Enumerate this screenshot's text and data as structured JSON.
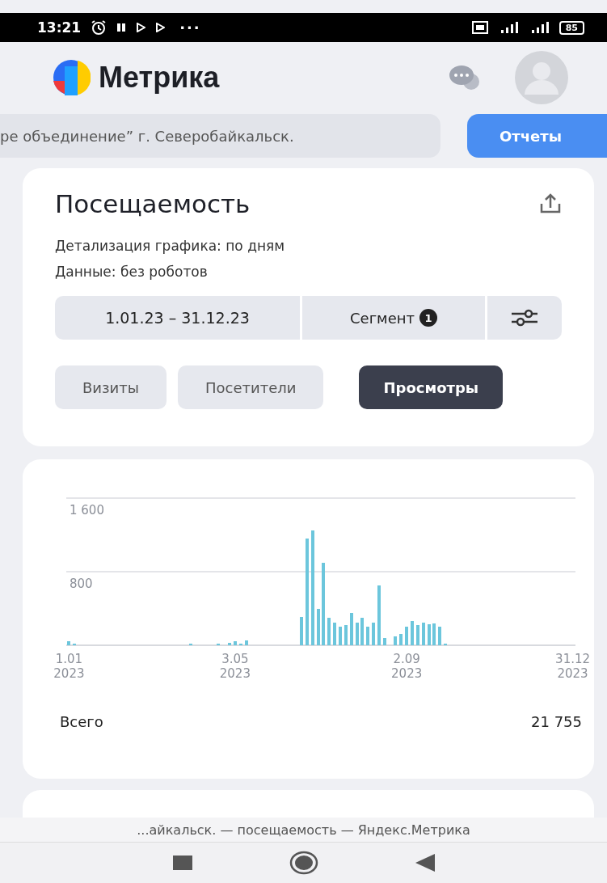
{
  "status_bar": {
    "time": "13:21",
    "more": "···",
    "battery": "85"
  },
  "header": {
    "title": "Метрика"
  },
  "counter_bar": {
    "counter_name": "ре объединение” г. Северобайкальск.",
    "reports_button": "Отчеты"
  },
  "report": {
    "title": "Посещаемость",
    "details": [
      "Детализация графика: по дням",
      "Данные: без роботов"
    ],
    "period": "1.01.23 – 31.12.23",
    "segment": {
      "label": "Сегмент",
      "count": "1"
    },
    "metric_tabs": [
      {
        "label": "Визиты",
        "selected": false
      },
      {
        "label": "Посетители",
        "selected": false
      },
      {
        "label": "Просмотры",
        "selected": true
      }
    ]
  },
  "chart_card": {
    "chart_data": {
      "type": "bar",
      "ylim": [
        0,
        1600
      ],
      "yticks": [
        {
          "value": 800,
          "label": "800"
        },
        {
          "value": 1600,
          "label": "1 600"
        }
      ],
      "categories": [
        "1.01 2023",
        null,
        null,
        null,
        null,
        null,
        null,
        null,
        null,
        null,
        null,
        null,
        null,
        null,
        null,
        null,
        null,
        null,
        null,
        null,
        null,
        null,
        null,
        null,
        null,
        null,
        null,
        null,
        null,
        null,
        "3.05 2023",
        null,
        null,
        null,
        null,
        null,
        null,
        null,
        null,
        null,
        null,
        null,
        null,
        null,
        null,
        null,
        null,
        null,
        null,
        null,
        null,
        null,
        null,
        null,
        null,
        null,
        null,
        null,
        null,
        null,
        null,
        "2.09 2023",
        null,
        null,
        null,
        null,
        null,
        null,
        null,
        null,
        null,
        null,
        null,
        null,
        null,
        null,
        null,
        null,
        null,
        null,
        null,
        null,
        null,
        null,
        null,
        null,
        null,
        null,
        null,
        null,
        null,
        "31.12 2023"
      ],
      "values": [
        40,
        20,
        0,
        0,
        0,
        0,
        0,
        0,
        0,
        0,
        0,
        0,
        0,
        0,
        0,
        0,
        0,
        0,
        0,
        0,
        0,
        0,
        20,
        0,
        0,
        0,
        0,
        20,
        0,
        30,
        40,
        20,
        50,
        0,
        0,
        0,
        0,
        0,
        0,
        0,
        0,
        0,
        310,
        1160,
        1250,
        400,
        900,
        300,
        250,
        200,
        220,
        350,
        250,
        300,
        200,
        250,
        650,
        80,
        0,
        100,
        120,
        200,
        260,
        220,
        250,
        230,
        240,
        200,
        20,
        0,
        0,
        0,
        0,
        0,
        0,
        0,
        0,
        0,
        0,
        0,
        0,
        0,
        0,
        0,
        0,
        0,
        0,
        0,
        0,
        0,
        0,
        0
      ]
    },
    "total_label": "Всего",
    "total_value": "21 755"
  },
  "browser_caption": "...айкальск. — посещаемость — Яндекс.Метрика"
}
